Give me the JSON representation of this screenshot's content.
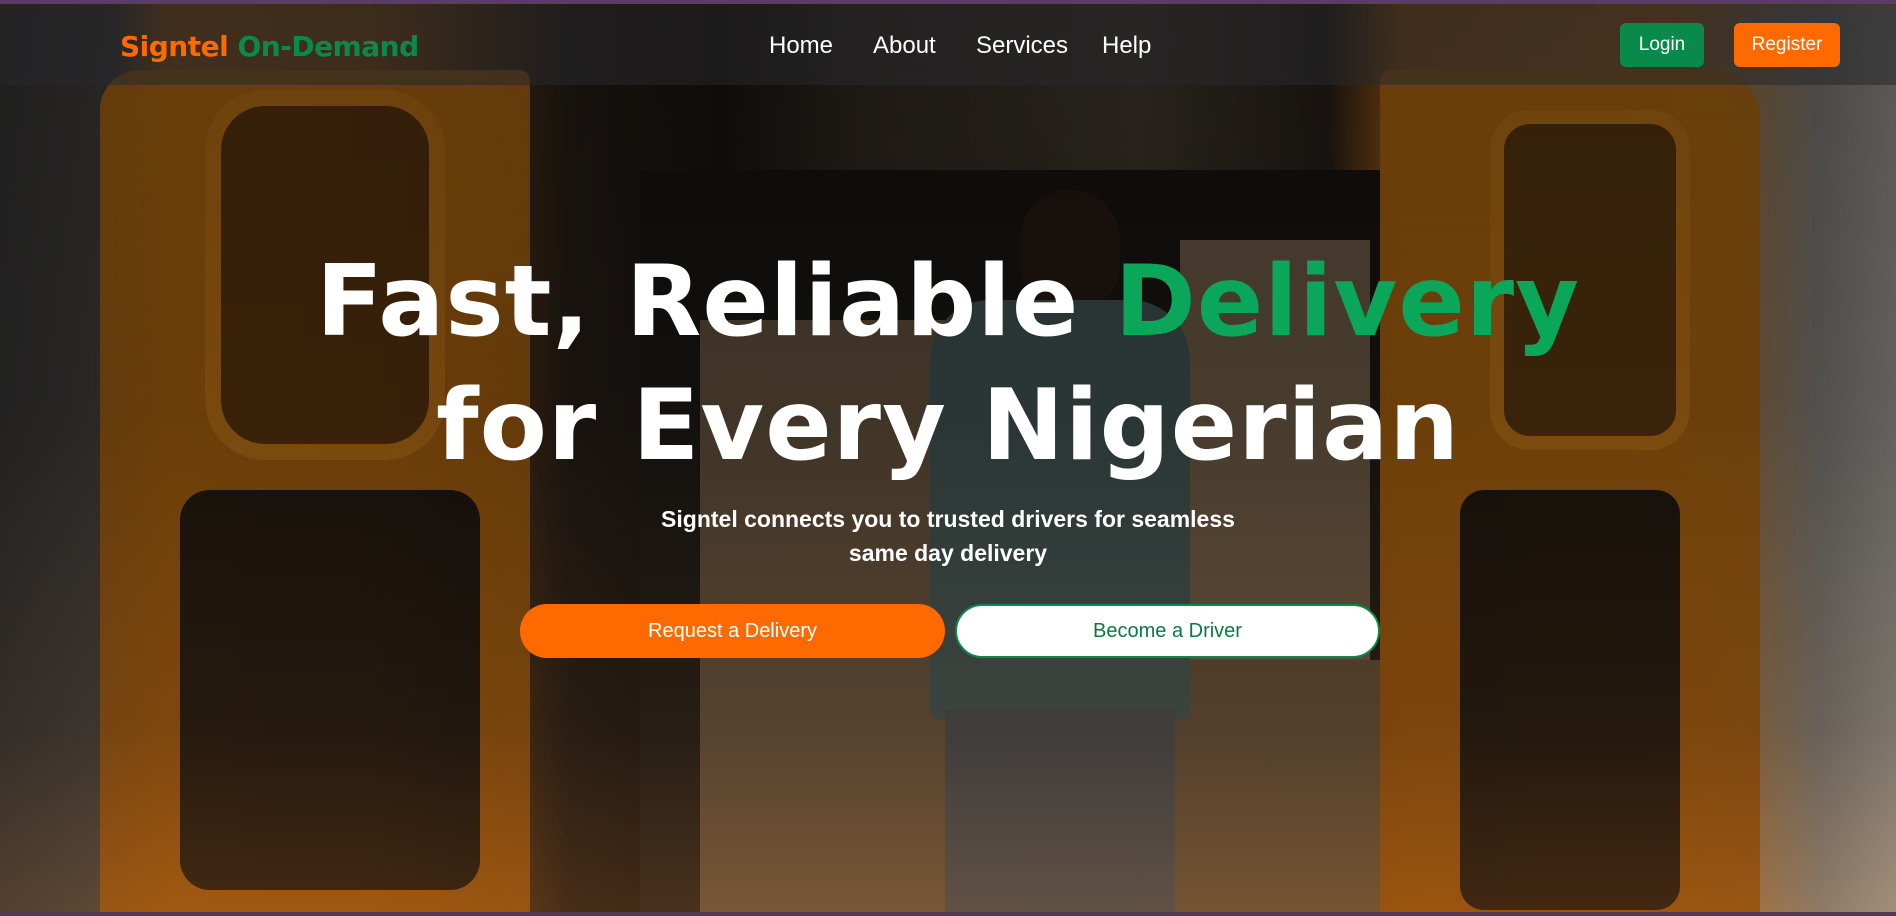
{
  "navbar": {
    "brand_part1": "Signtel",
    "brand_part2": "On-Demand",
    "links": [
      "Home",
      "About",
      "Services",
      "Help"
    ],
    "login_label": "Login",
    "register_label": "Register"
  },
  "hero": {
    "headline_part1": "Fast, Reliable ",
    "headline_accent": "Delivery",
    "headline_line2": "for Every Nigerian",
    "subtext": "Signtel connects you to trusted drivers for seamless same day delivery",
    "cta_primary": "Request a Delivery",
    "cta_secondary": "Become a Driver"
  },
  "colors": {
    "brand_orange": "#ff6a00",
    "brand_green": "#0a8a4a",
    "accent_green": "#0aa65a"
  }
}
